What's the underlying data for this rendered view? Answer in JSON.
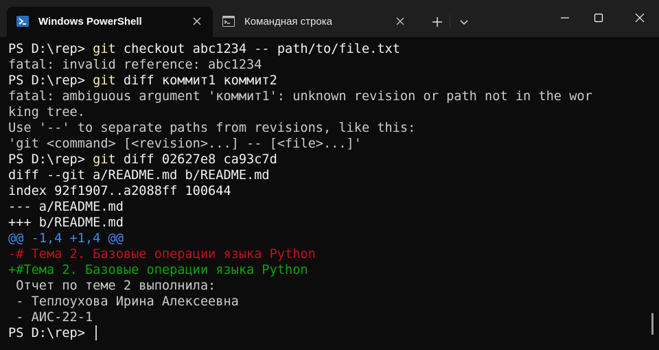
{
  "window": {
    "tabs": [
      {
        "label": "Windows PowerShell",
        "icon": "powershell-icon",
        "active": true
      },
      {
        "label": "Командная строка",
        "icon": "cmd-icon",
        "active": false
      }
    ],
    "new_tab_icon": "plus-icon",
    "dropdown_icon": "chevron-down-icon",
    "controls": [
      "minimize-icon",
      "maximize-icon",
      "close-icon"
    ]
  },
  "colors": {
    "background": "#0c0c0c",
    "titlebar": "#1f1f1f",
    "text": "#cccccc",
    "command": "#f9f1a5",
    "diff_hunk": "#3b8eea",
    "diff_removed": "#c50f1f",
    "diff_added": "#13a10e",
    "powershell_icon": "#2671be"
  },
  "terminal": {
    "lines": [
      {
        "prompt": "PS D:\\rep> ",
        "cmd": "git",
        "args": " checkout abc1234 -- path/to/file.txt"
      },
      {
        "text": "fatal: invalid reference: abc1234"
      },
      {
        "prompt": "PS D:\\rep> ",
        "cmd": "git",
        "args": " diff коммит1 коммит2"
      },
      {
        "text": "fatal: ambiguous argument 'коммит1': unknown revision or path not in the wor"
      },
      {
        "text": "king tree."
      },
      {
        "text": "Use '--' to separate paths from revisions, like this:"
      },
      {
        "text": "'git <command> [<revision>...] -- [<file>...]'"
      },
      {
        "prompt": "PS D:\\rep> ",
        "cmd": "git",
        "args": " diff 02627e8 ca93c7d"
      },
      {
        "text": "diff --git a/README.md b/README.md",
        "style": "bold"
      },
      {
        "text": "index 92f1907..a2088ff 100644",
        "style": "bold"
      },
      {
        "text": "--- a/README.md",
        "style": "bold"
      },
      {
        "text": "+++ b/README.md",
        "style": "bold"
      },
      {
        "text": "@@ -1,4 +1,4 @@",
        "style": "hunk"
      },
      {
        "text": "-# Тема 2. Базовые операции языка Python",
        "style": "removed"
      },
      {
        "text": "+#Тема 2. Базовые операции языка Python",
        "style": "added"
      },
      {
        "text": " Отчет по теме 2 выполнила:"
      },
      {
        "text": " - Теплоухова Ирина Алексеевна"
      },
      {
        "text": " - АИС-22-1"
      },
      {
        "prompt": "PS D:\\rep> ",
        "current": true
      }
    ]
  }
}
